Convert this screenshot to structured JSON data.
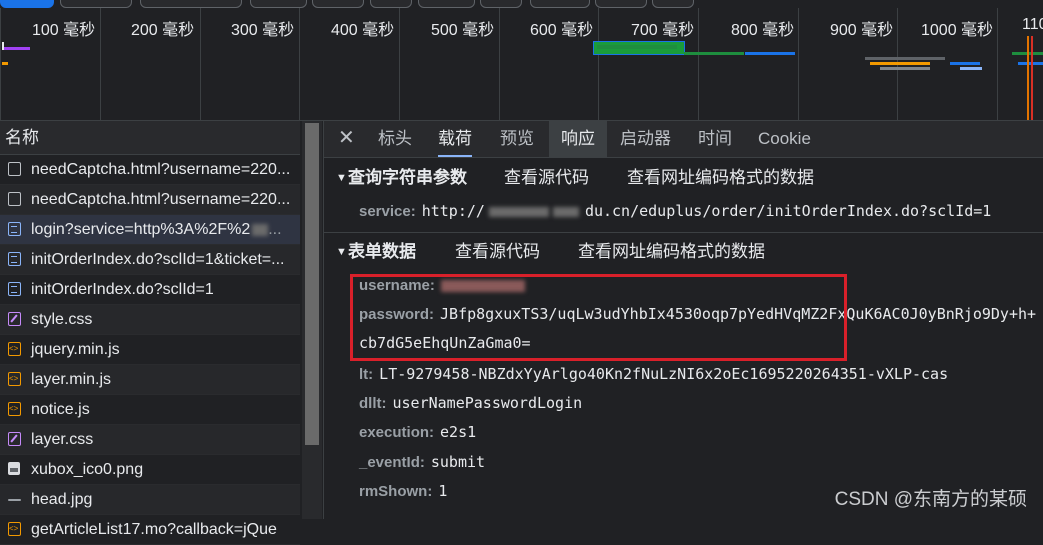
{
  "timeline": {
    "ticks": [
      "100 毫秒",
      "200 毫秒",
      "300 毫秒",
      "400 毫秒",
      "500 毫秒",
      "600 毫秒",
      "700 毫秒",
      "800 毫秒",
      "900 毫秒",
      "1000 毫秒",
      "110"
    ]
  },
  "request_list": {
    "header": "名称",
    "rows": [
      {
        "name": "needCaptcha.html?username=220...",
        "icon": "checkbox-icon"
      },
      {
        "name": "needCaptcha.html?username=220...",
        "icon": "checkbox-icon"
      },
      {
        "name": "login?service=http%3A%2F%2",
        "icon": "document-icon"
      },
      {
        "name": "initOrderIndex.do?sclId=1&ticket=...",
        "icon": "document-icon"
      },
      {
        "name": "initOrderIndex.do?sclId=1",
        "icon": "document-icon"
      },
      {
        "name": "style.css",
        "icon": "stylesheet-icon"
      },
      {
        "name": "jquery.min.js",
        "icon": "script-icon"
      },
      {
        "name": "layer.min.js",
        "icon": "script-icon"
      },
      {
        "name": "notice.js",
        "icon": "script-icon"
      },
      {
        "name": "layer.css",
        "icon": "stylesheet-icon"
      },
      {
        "name": "xubox_ico0.png",
        "icon": "image-icon"
      },
      {
        "name": "head.jpg",
        "icon": "image-icon"
      },
      {
        "name": "getArticleList17.mo?callback=jQue",
        "icon": "script-icon"
      }
    ]
  },
  "tabs": [
    "标头",
    "载荷",
    "预览",
    "响应",
    "启动器",
    "时间",
    "Cookie"
  ],
  "query_section": {
    "title": "查询字符串参数",
    "view_source": "查看源代码",
    "view_url_encoded": "查看网址编码格式的数据",
    "params": [
      {
        "key": "service:",
        "value_prefix": "http://",
        "value_suffix": "du.cn/eduplus/order/initOrderIndex.do?sclId=1"
      }
    ]
  },
  "form_section": {
    "title": "表单数据",
    "view_source": "查看源代码",
    "view_url_encoded": "查看网址编码格式的数据",
    "fields": [
      {
        "key": "username:",
        "value": ""
      },
      {
        "key": "password:",
        "value": "JBfp8gxuxTS3/uqLw3udYhbIx4530oqp7pYedHVqMZ2FxQuK6AC0J0yBnRjo9Dy+h+"
      },
      {
        "key": "",
        "value": "cb7dG5eEhqUnZaGma0="
      },
      {
        "key": "lt:",
        "value": "LT-9279458-NBZdxYyArlgo40Kn2fNuLzNI6x2oEc1695220264351-vXLP-cas"
      },
      {
        "key": "dllt:",
        "value": "userNamePasswordLogin"
      },
      {
        "key": "execution:",
        "value": "e2s1"
      },
      {
        "key": "_eventId:",
        "value": "submit"
      },
      {
        "key": "rmShown:",
        "value": "1"
      }
    ]
  },
  "watermark": "CSDN @东南方的某硕",
  "colors": {
    "accent": "#8ab4f8",
    "highlight_box": "#d9202a",
    "background": "#202124"
  }
}
